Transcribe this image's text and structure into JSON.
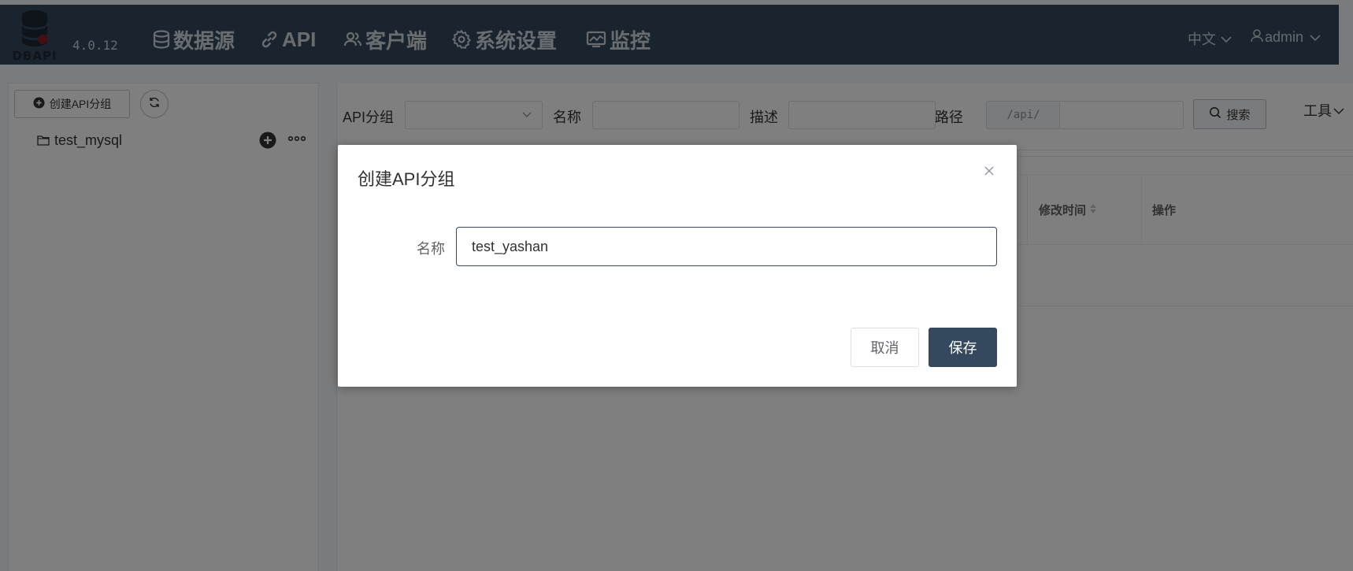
{
  "header": {
    "logo_text": "DBAPI",
    "version": "4.0.12",
    "nav": [
      {
        "label": "数据源",
        "icon": "database-icon"
      },
      {
        "label": "API",
        "icon": "link-icon"
      },
      {
        "label": "客户端",
        "icon": "users-icon"
      },
      {
        "label": "系统设置",
        "icon": "gear-icon"
      },
      {
        "label": "监控",
        "icon": "monitor-chart-icon"
      }
    ],
    "language": "中文",
    "user": "admin"
  },
  "sidebar": {
    "create_group_label": "创建API分组",
    "groups": [
      {
        "label": "test_mysql"
      }
    ]
  },
  "filters": {
    "group_label": "API分组",
    "group_value": "",
    "name_label": "名称",
    "name_value": "",
    "desc_label": "描述",
    "desc_value": "",
    "path_label": "路径",
    "path_prefix": "/api/",
    "path_value": "",
    "search_label": "搜索",
    "tools_label": "工具"
  },
  "table": {
    "columns": [
      "修改时间",
      "操作"
    ]
  },
  "dialog": {
    "title": "创建API分组",
    "name_label": "名称",
    "name_value": "test_yashan",
    "cancel_label": "取消",
    "save_label": "保存"
  },
  "colors": {
    "header_bg": "#34495e",
    "primary": "#34495e",
    "overlay": "rgba(0,0,0,0.5)"
  }
}
